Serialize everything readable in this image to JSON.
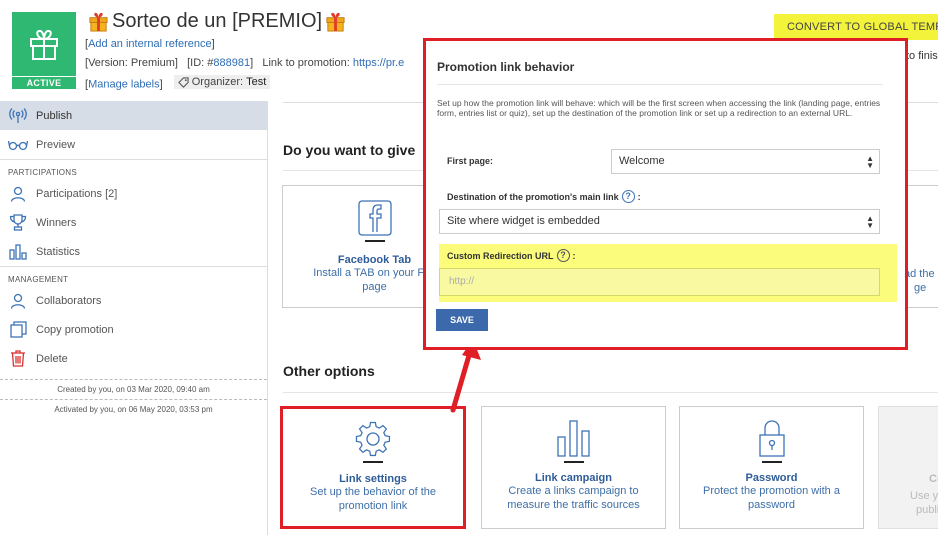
{
  "header": {
    "title": "Sorteo de un [PREMIO]",
    "status_badge": "ACTIVE",
    "internal_reference_link": "Add an internal reference",
    "version_label": "Version: Premium",
    "id_prefix": "ID: #",
    "id_value": "888981",
    "link_to_promotion_label": "Link to promotion:",
    "link_to_promotion_url": "https://pr.e",
    "manage_labels": "Manage labels",
    "organizer_label": "Organizer:",
    "organizer_value": "Test",
    "convert_button": "CONVERT TO GLOBAL TEMPLATE",
    "to_finish_text": "to finis"
  },
  "sidebar": {
    "items": [
      {
        "label": "Publish",
        "icon": "broadcast-icon",
        "active": true
      },
      {
        "label": "Preview",
        "icon": "glasses-icon"
      }
    ],
    "participations_section": "PARTICIPATIONS",
    "participations_items": [
      {
        "label": "Participations [2]",
        "icon": "user-icon"
      },
      {
        "label": "Winners",
        "icon": "trophy-icon"
      },
      {
        "label": "Statistics",
        "icon": "bar-chart-icon"
      }
    ],
    "management_section": "MANAGEMENT",
    "management_items": [
      {
        "label": "Collaborators",
        "icon": "user-icon"
      },
      {
        "label": "Copy promotion",
        "icon": "copy-icon"
      },
      {
        "label": "Delete",
        "icon": "trash-icon"
      }
    ],
    "created_note": "Created by you, on 03 Mar 2020, 09:40 am",
    "activated_note": "Activated by you, on 06 May 2020, 03:53 pm"
  },
  "main": {
    "give_title": "Do you want to give",
    "facebook_card": {
      "title": "Facebook Tab",
      "desc_line1": "Install a TAB on your Fac",
      "desc_line2": "page"
    },
    "right_partial_text": "ad the",
    "right_partial_text2": "ge",
    "other_options_title": "Other options",
    "cards": [
      {
        "title": "Link settings",
        "desc_line1": "Set up the behavior of the",
        "desc_line2": "promotion link",
        "icon": "gear-icon"
      },
      {
        "title": "Link campaign",
        "desc_line1": "Create a links campaign to",
        "desc_line2": "measure the traffic sources",
        "icon": "bar-chart-icon"
      },
      {
        "title": "Password",
        "desc_line1": "Protect the promotion with a",
        "desc_line2": "password",
        "icon": "lock-icon"
      },
      {
        "title": "Cu",
        "desc_line1": "Use y",
        "desc_line2": "publi"
      }
    ]
  },
  "modal": {
    "title": "Promotion link behavior",
    "description": "Set up how the promotion link will behave: which will be the first screen when accessing the link (landing page, entries form, entries list or quiz), set up the destination of the promotion link or set up a redirection to an external URL.",
    "first_page_label": "First page:",
    "first_page_value": "Welcome",
    "destination_label": "Destination of the promotion's main link",
    "destination_value": "Site where widget is embedded",
    "custom_url_label": "Custom Redirection URL",
    "custom_url_placeholder": "http://",
    "save_button": "SAVE"
  },
  "colors": {
    "accent_green": "#2fb872",
    "link_blue": "#2e6db4",
    "save_blue": "#3c69ab",
    "highlight_yellow": "#fbfb7c",
    "annotation_red": "#e01e25",
    "convert_yellow": "#f3f33c"
  }
}
